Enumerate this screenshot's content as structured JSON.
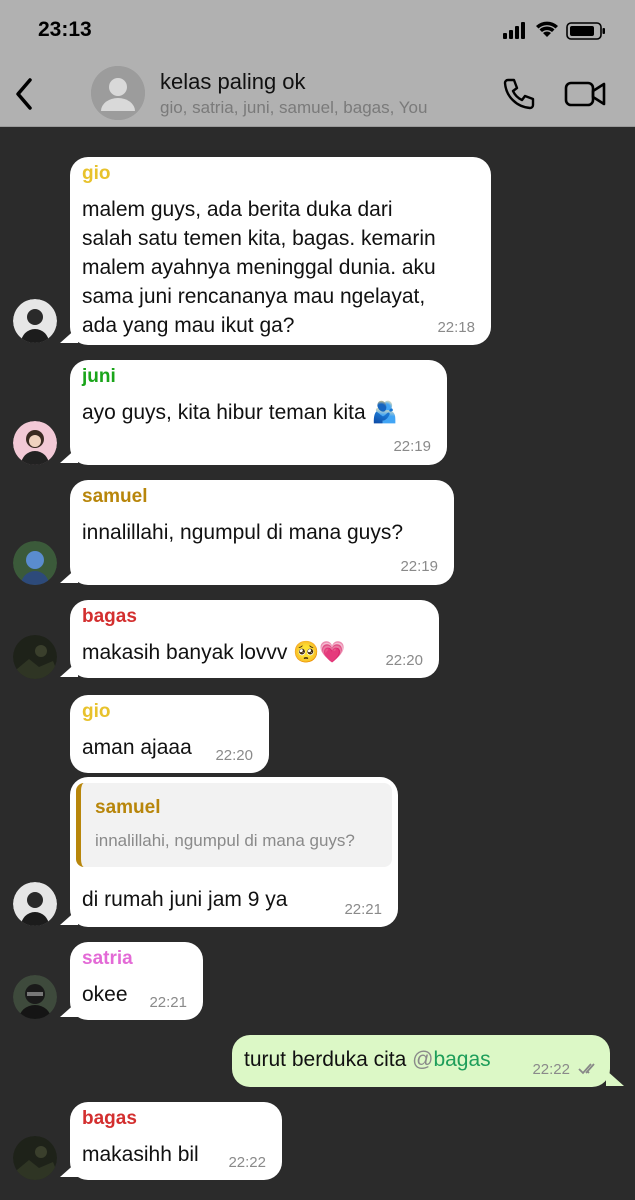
{
  "status_bar": {
    "time": "23:13",
    "icons": [
      "signal-icon",
      "wifi-icon",
      "battery-icon"
    ]
  },
  "header": {
    "title": "kelas paling ok",
    "members": "gio, satria, juni, samuel, bagas, You",
    "icons": [
      "back-icon",
      "group-avatar-icon",
      "phone-icon",
      "video-icon"
    ]
  },
  "colors": {
    "gio": "#e8c22c",
    "juni": "#1aa51a",
    "samuel": "#b8860b",
    "bagas": "#d32f2f",
    "satria": "#e36ad6",
    "out_bubble": "#dcf8c6",
    "background": "#2b2b2b"
  },
  "messages": [
    {
      "sender": "gio",
      "text": "malem guys, ada berita duka dari\nsalah satu temen kita, bagas. kemarin\nmalem ayahnya meninggal dunia. aku\nsama juni rencananya mau ngelayat,\nada yang mau ikut ga?",
      "time": "22:18"
    },
    {
      "sender": "juni",
      "text": "ayo guys, kita hibur teman kita",
      "emoji": "🫂",
      "time": "22:19"
    },
    {
      "sender": "samuel",
      "text": "innalillahi, ngumpul di mana guys?",
      "time": "22:19"
    },
    {
      "sender": "bagas",
      "text": "makasih banyak lovvv",
      "emoji": "🥺💗",
      "time": "22:20"
    },
    {
      "sender": "gio",
      "text": "aman ajaaa",
      "time": "22:20"
    },
    {
      "quote": {
        "sender": "samuel",
        "text": "innalillahi, ngumpul di mana guys?"
      },
      "text": "di rumah juni jam 9 ya",
      "time": "22:21"
    },
    {
      "sender": "satria",
      "text": "okee",
      "time": "22:21"
    },
    {
      "outgoing": true,
      "text": "turut berduka cita",
      "mention_at": "@",
      "mention": "bagas",
      "time": "22:22"
    },
    {
      "sender": "bagas",
      "text": "makasihh bil",
      "time": "22:22"
    }
  ]
}
